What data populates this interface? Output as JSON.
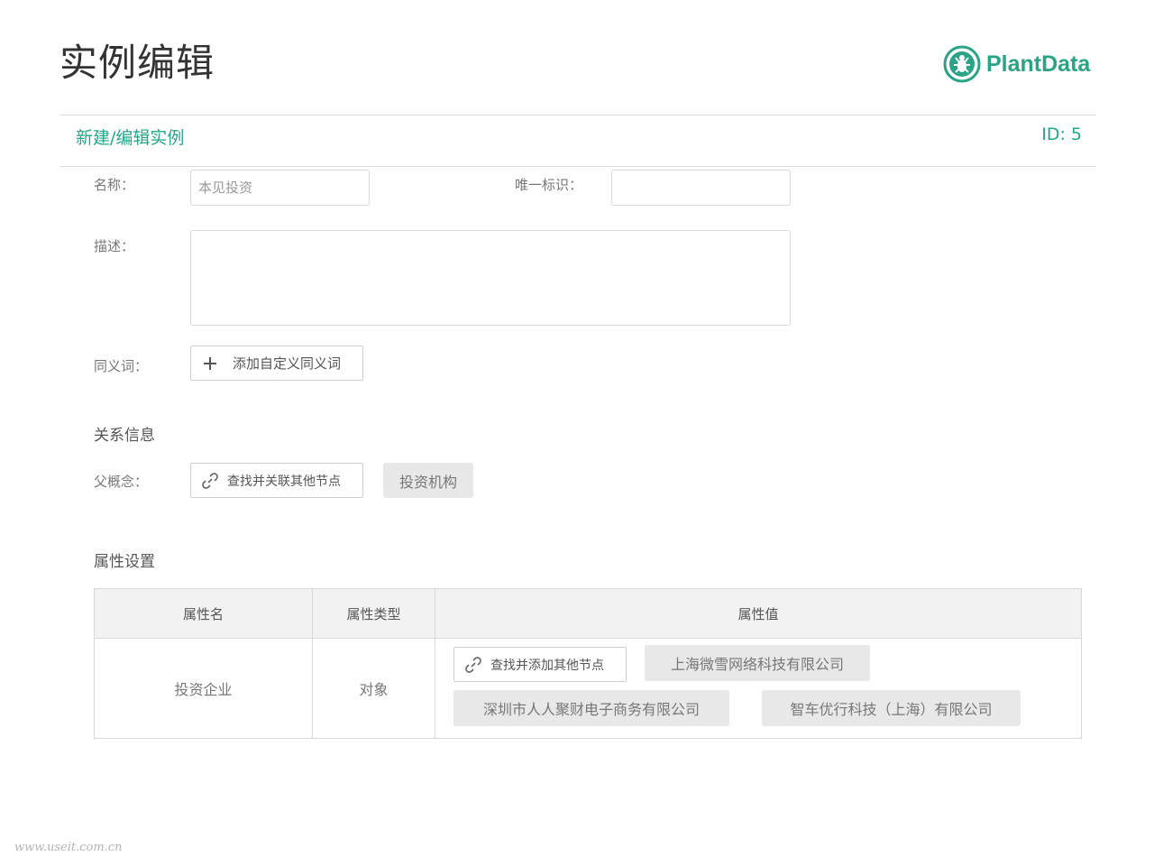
{
  "header": {
    "title": "实例编辑",
    "logo_text": "PlantData",
    "brand_color": "#2aa387"
  },
  "form_header": {
    "title": "新建/编辑实例",
    "id_label": "ID: 5"
  },
  "fields": {
    "name_label": "名称：",
    "name_placeholder": "本见投资",
    "unique_id_label": "唯一标识：",
    "unique_id_value": "",
    "description_label": "描述：",
    "description_value": "",
    "synonym_label": "同义词：",
    "synonym_button": "添加自定义同义词"
  },
  "relations": {
    "title": "关系信息",
    "parent_label": "父概念：",
    "find_button": "查找并关联其他节点",
    "parent_tags": [
      "投资机构"
    ]
  },
  "attributes": {
    "title": "属性设置",
    "columns": [
      "属性名",
      "属性类型",
      "属性值"
    ],
    "rows": [
      {
        "name": "投资企业",
        "type": "对象",
        "add_button": "查找并添加其他节点",
        "values": [
          "上海微雪网络科技有限公司",
          "深圳市人人聚财电子商务有限公司",
          "智车优行科技（上海）有限公司"
        ]
      }
    ]
  },
  "watermark": "www.useit.com.cn"
}
